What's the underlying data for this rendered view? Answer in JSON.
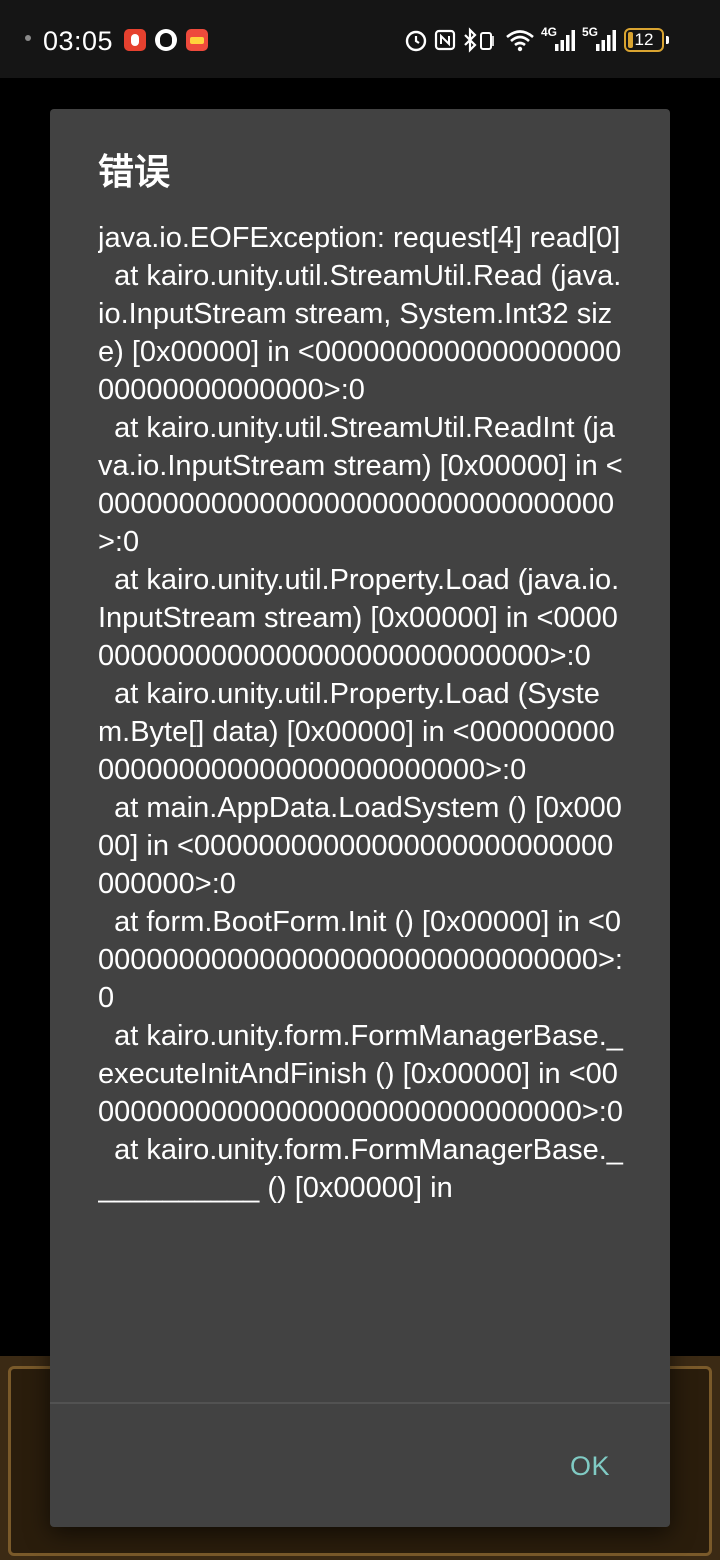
{
  "status_bar": {
    "time": "03:05",
    "battery_level": "12",
    "network_1": "4G",
    "network_2": "5G",
    "icons": [
      "red-app-notification-icon",
      "qq-icon",
      "app-notification-icon",
      "alarm-icon",
      "nfc-icon",
      "bluetooth-vibrate-icon",
      "wifi-icon",
      "signal-4g-icon",
      "signal-5g-icon",
      "battery-icon"
    ]
  },
  "dialog": {
    "title": "错误",
    "message": "java.io.EOFException: request[4] read[0]\n  at kairo.unity.util.StreamUtil.Read (java.io.InputStream stream, System.Int32 size) [0x00000] in <000000000000000000000000000000000>:0\n  at kairo.unity.util.StreamUtil.ReadInt (java.io.InputStream stream) [0x00000] in <00000000000000000000000000000000>:0\n  at kairo.unity.util.Property.Load (java.io.InputStream stream) [0x00000] in <00000000000000000000000000000000>:0\n  at kairo.unity.util.Property.Load (System.Byte[] data) [0x00000] in <000000000000000000000000000000000>:0\n  at main.AppData.LoadSystem () [0x00000] in <00000000000000000000000000000000>:0\n  at form.BootForm.Init () [0x00000] in <00000000000000000000000000000000>:0\n  at kairo.unity.form.FormManagerBase._executeInitAndFinish () [0x00000] in <00000000000000000000000000000000>:0\n  at kairo.unity.form.FormManagerBase.___________ () [0x00000] in",
    "ok_label": "OK"
  },
  "colors": {
    "dialog_background": "#424242",
    "accent": "#80cbc4",
    "battery": "#d9a431"
  }
}
